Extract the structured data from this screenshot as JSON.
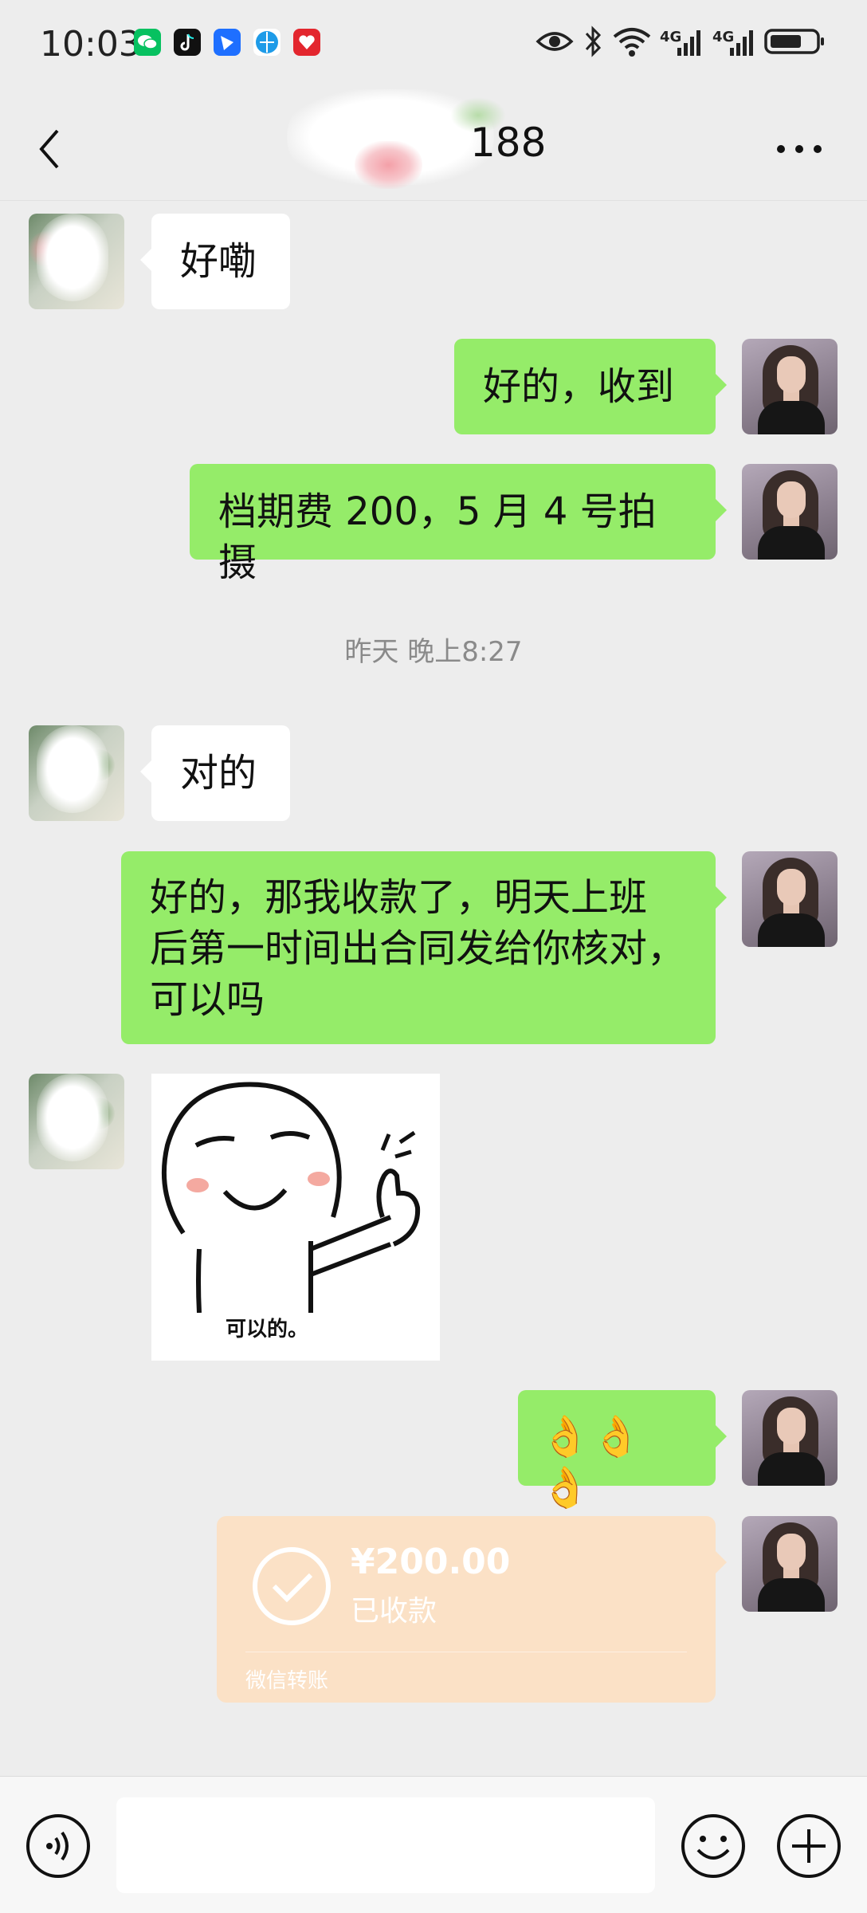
{
  "status_bar": {
    "time": "10:03",
    "network_1": "4G",
    "network_2": "4G",
    "app_icons": [
      "wechat-icon",
      "tiktok-icon",
      "feishu-icon",
      "browser-icon",
      "red-app-icon"
    ]
  },
  "header": {
    "title": "188"
  },
  "messages": [
    {
      "side": "in",
      "text": "好嘞"
    },
    {
      "side": "out",
      "text": "好的，收到"
    },
    {
      "side": "out",
      "text": "档期费 200，5 月 4 号拍摄"
    },
    {
      "side": "in",
      "text": "对的"
    },
    {
      "side": "out",
      "text": "好的，那我收款了，明天上班\n后第一时间出合同发给你核对，\n可以吗"
    },
    {
      "side": "out",
      "text": "👌👌👌"
    }
  ],
  "timestamp": "昨天 晚上8:27",
  "sticker": {
    "caption": "可以的。"
  },
  "transfer": {
    "amount": "¥200.00",
    "status": "已收款",
    "label": "微信转账"
  },
  "input_bar": {
    "placeholder": ""
  },
  "colors": {
    "background": "#ededed",
    "outgoing_bubble": "#95ec69",
    "incoming_bubble": "#ffffff",
    "transfer_card": "#fbe1c6"
  }
}
